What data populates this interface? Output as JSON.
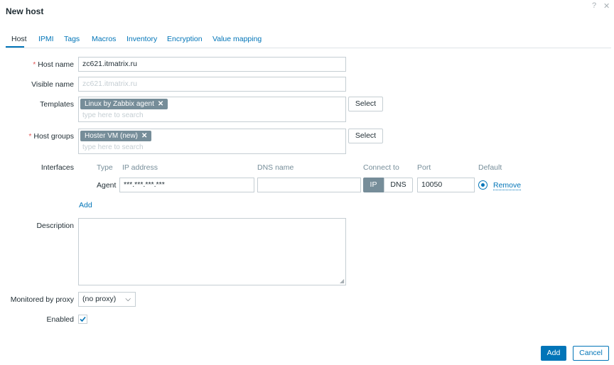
{
  "dialog": {
    "title": "New host",
    "help_icon": "?",
    "close_icon": "✕"
  },
  "tabs": [
    {
      "label": "Host"
    },
    {
      "label": "IPMI"
    },
    {
      "label": "Tags"
    },
    {
      "label": "Macros"
    },
    {
      "label": "Inventory"
    },
    {
      "label": "Encryption"
    },
    {
      "label": "Value mapping"
    }
  ],
  "form": {
    "host_name": {
      "label": "Host name",
      "required_mark": "*",
      "value": "zc621.itmatrix.ru"
    },
    "visible_name": {
      "label": "Visible name",
      "placeholder": "zc621.itmatrix.ru"
    },
    "templates": {
      "label": "Templates",
      "chips": [
        "Linux by Zabbix agent"
      ],
      "placeholder": "type here to search",
      "select_label": "Select"
    },
    "host_groups": {
      "label": "Host groups",
      "required_mark": "*",
      "chips": [
        "Hoster VM (new)"
      ],
      "placeholder": "type here to search",
      "select_label": "Select"
    },
    "interfaces": {
      "label": "Interfaces",
      "columns": {
        "type": "Type",
        "ip": "IP address",
        "dns": "DNS name",
        "connect": "Connect to",
        "port": "Port",
        "default": "Default"
      },
      "rows": [
        {
          "type": "Agent",
          "ip": "***.***.***.***",
          "dns": "",
          "connect_ip": "IP",
          "connect_dns": "DNS",
          "port": "10050",
          "remove": "Remove"
        }
      ],
      "add_label": "Add"
    },
    "description": {
      "label": "Description",
      "value": ""
    },
    "proxy": {
      "label": "Monitored by proxy",
      "value": "(no proxy)"
    },
    "enabled": {
      "label": "Enabled",
      "checked": true
    }
  },
  "footer": {
    "add_label": "Add",
    "cancel_label": "Cancel"
  }
}
